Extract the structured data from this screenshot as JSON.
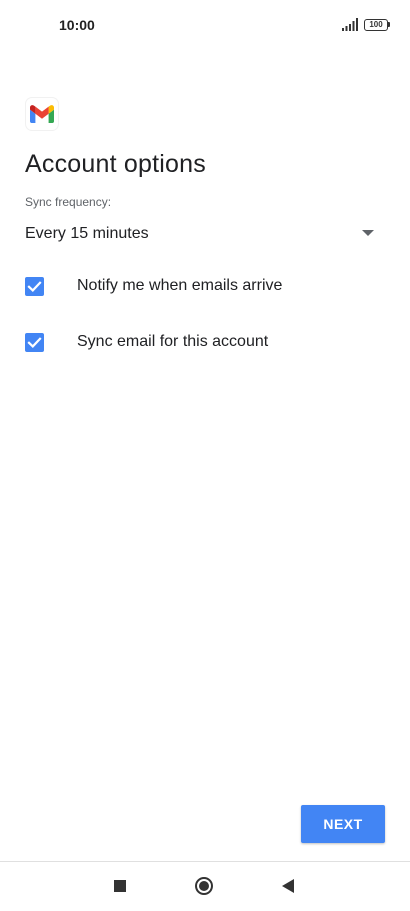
{
  "status_bar": {
    "time": "10:00",
    "signal_icon": "signal-icon",
    "battery_icon": "battery-icon",
    "battery_level": "100"
  },
  "header": {
    "logo_icon": "gmail-logo-icon",
    "title": "Account options"
  },
  "sync": {
    "label": "Sync frequency:",
    "selected_value": "Every 15 minutes",
    "arrow_icon": "dropdown-arrow-icon"
  },
  "options": [
    {
      "label": "Notify me when emails arrive",
      "checked": true
    },
    {
      "label": "Sync email for this account",
      "checked": true
    }
  ],
  "actions": {
    "next_label": "NEXT"
  },
  "nav_bar": {
    "recent_icon": "recent-apps-icon",
    "home_icon": "home-icon",
    "back_icon": "back-icon"
  },
  "colors": {
    "accent": "#4285f4",
    "text_primary": "#202124",
    "text_secondary": "#5f6368"
  }
}
